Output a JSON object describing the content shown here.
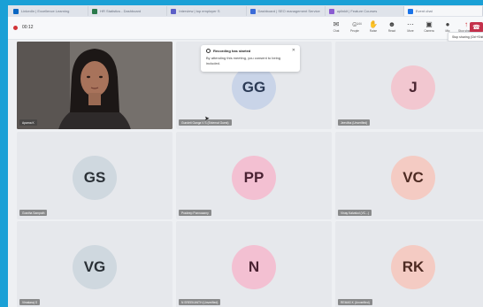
{
  "browser": {
    "tabs": [
      {
        "label": "LinkedIn | Excellence Learning",
        "color": "#0a66c2"
      },
      {
        "label": "HR Statistics - Dashboard",
        "color": "#2b7a4b"
      },
      {
        "label": "Interview | top employer S",
        "color": "#5b5fc7"
      },
      {
        "label": "Dashboard | SEO management Service",
        "color": "#3a6bd8"
      },
      {
        "label": "uplinkit | Feature Courses",
        "color": "#8a5cd1"
      },
      {
        "label": "Event chat",
        "color": "#1a73e8"
      }
    ]
  },
  "meeting": {
    "elapsed": "00:12",
    "tools": [
      {
        "name": "chat",
        "icon": "✉",
        "label": "Chat"
      },
      {
        "name": "people",
        "icon": "☺",
        "label": "People"
      },
      {
        "name": "raise",
        "icon": "✋",
        "label": "Raise"
      },
      {
        "name": "react",
        "icon": "☻",
        "label": "React"
      },
      {
        "name": "more",
        "icon": "⋯",
        "label": "More"
      },
      {
        "name": "camera",
        "icon": "▣",
        "label": "Camera"
      },
      {
        "name": "mic",
        "icon": "●",
        "label": "Mic"
      },
      {
        "name": "share",
        "icon": "↑",
        "label": "Stop sharing"
      }
    ],
    "people_count": "144",
    "leave_icon": "☎",
    "tooltip": "Stop sharing (Ctrl+Shift+E)"
  },
  "notice": {
    "title": "Recording has started",
    "body": "By attending this meeting, you consent to being included."
  },
  "participants": [
    {
      "type": "video",
      "name": "Aparna K"
    },
    {
      "type": "avatar",
      "initials": "GG",
      "name": "Gundeti Ganga V S (External Guest)",
      "bg": "#c9d4e8",
      "fg": "#2b3a55"
    },
    {
      "type": "avatar",
      "initials": "J",
      "name": "Jeevitha (Unverified)",
      "bg": "#f2c7d0",
      "fg": "#4a2530"
    },
    {
      "type": "avatar",
      "initials": "GS",
      "name": "Gowtha Sampath",
      "bg": "#cfd8df",
      "fg": "#2a3036"
    },
    {
      "type": "avatar",
      "initials": "PP",
      "name": "Pradeep Ponnusamy",
      "bg": "#f3c0d2",
      "fg": "#4a2232"
    },
    {
      "type": "avatar",
      "initials": "VC",
      "name": "Vinay Kalvakol (VC...)",
      "bg": "#f4cbc3",
      "fg": "#4d2a22"
    },
    {
      "type": "avatar",
      "initials": "VG",
      "name": "Vimalaraj G",
      "bg": "#cfd8df",
      "fg": "#2a3036"
    },
    {
      "type": "avatar",
      "initials": "N",
      "name": "N SREEKANTH (Unverified)",
      "bg": "#f3c0d2",
      "fg": "#4a2232"
    },
    {
      "type": "avatar",
      "initials": "RK",
      "name": "REMAS K (Unverified)",
      "bg": "#f4cbc3",
      "fg": "#4d2a22"
    }
  ]
}
